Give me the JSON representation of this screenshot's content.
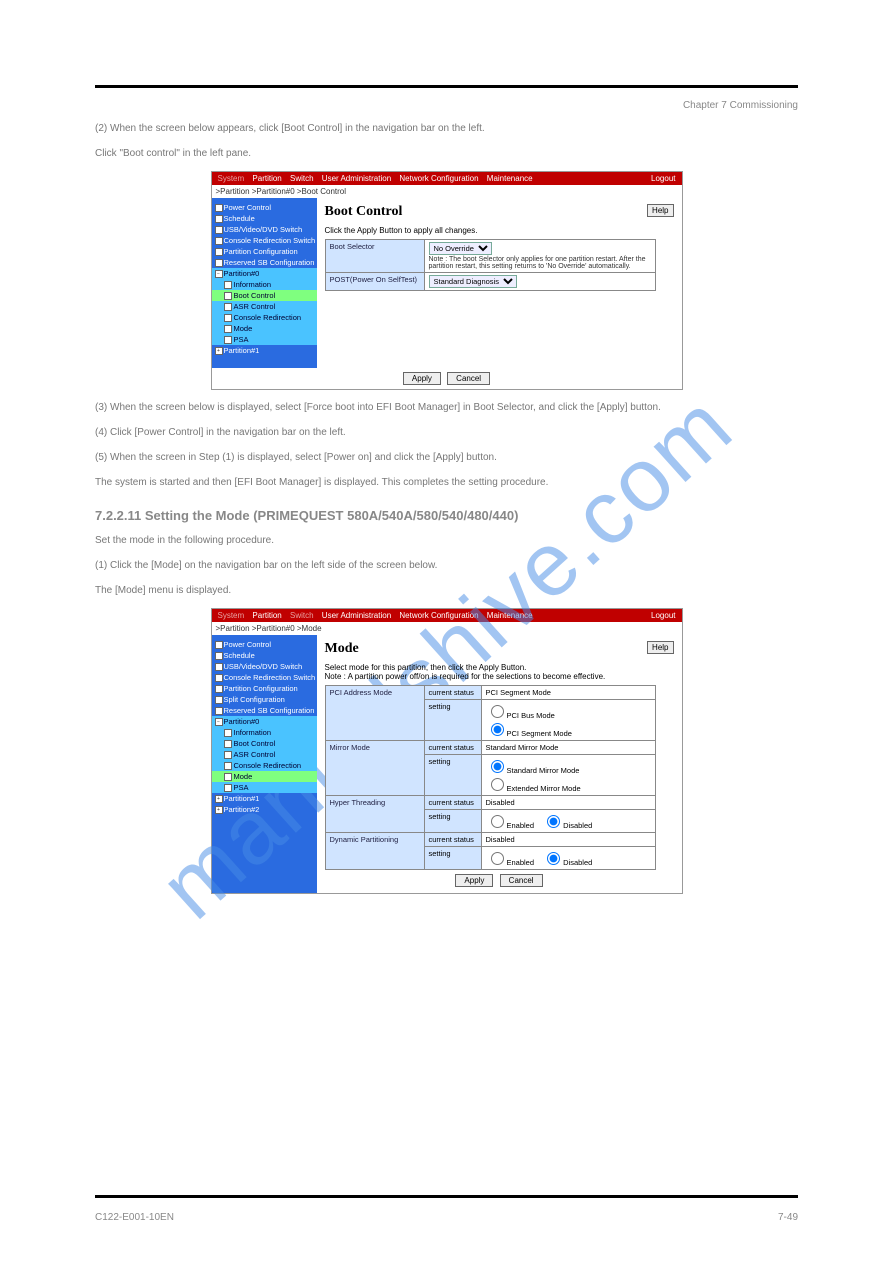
{
  "header": {
    "chapter": "Chapter 7 Commissioning"
  },
  "watermark": "manualshive.com",
  "intro": {
    "line1": "(2) When the screen below appears, click [Boot Control] in the navigation bar on the left.",
    "line2": "Click \"Boot control\" in the left pane."
  },
  "screenshot1": {
    "nav": [
      "System",
      "Partition",
      "Switch",
      "User Administration",
      "Network Configuration",
      "Maintenance"
    ],
    "logout": "Logout",
    "breadcrumb": ">Partition >Partition#0 >Boot Control",
    "sidebar": [
      "Power Control",
      "Schedule",
      "USB/Video/DVD Switch",
      "Console Redirection Switch",
      "Partition Configuration",
      "Reserved SB Configuration",
      "Partition#0",
      "Partition#1"
    ],
    "subitems": [
      "Information",
      "Boot Control",
      "ASR Control",
      "Console Redirection",
      "Mode",
      "PSA"
    ],
    "title": "Boot Control",
    "help": "Help",
    "instruction": "Click the Apply Button to apply all changes.",
    "rows": {
      "boot_selector_label": "Boot Selector",
      "boot_selector_value": "No Override",
      "boot_selector_note": "Note : The boot Selector only applies for one partition restart. After the partition restart, this setting returns to 'No Override' automatically.",
      "post_label": "POST(Power On SelfTest)",
      "post_value": "Standard Diagnosis"
    },
    "buttons": {
      "apply": "Apply",
      "cancel": "Cancel"
    }
  },
  "midtext": {
    "p1": "(3) When the screen below is displayed, select [Force boot into EFI Boot Manager] in Boot Selector, and click the [Apply] button.",
    "p2": "(4) Click [Power Control] in the navigation bar on the left.",
    "p3": "(5) When the screen in Step (1) is displayed, select [Power on] and click the [Apply] button.",
    "p4": "The system is started and then [EFI Boot Manager] is displayed. This completes the setting procedure.",
    "h": "7.2.2.11 Setting the Mode (PRIMEQUEST 580A/540A/580/540/480/440)",
    "p5": "Set the mode in the following procedure.",
    "p6": "(1) Click the [Mode] on the navigation bar on the left side of the screen below.",
    "p7": "The [Mode] menu is displayed."
  },
  "screenshot2": {
    "nav": [
      "System",
      "Partition",
      "Switch",
      "User Administration",
      "Network Configuration",
      "Maintenance"
    ],
    "logout": "Logout",
    "breadcrumb": ">Partition >Partition#0 >Mode",
    "sidebar": [
      "Power Control",
      "Schedule",
      "USB/Video/DVD Switch",
      "Console Redirection Switch",
      "Partition Configuration",
      "Split Configuration",
      "Reserved SB Configuration",
      "Partition#0",
      "Partition#1",
      "Partition#2"
    ],
    "subitems": [
      "Information",
      "Boot Control",
      "ASR Control",
      "Console Redirection",
      "Mode",
      "PSA"
    ],
    "title": "Mode",
    "help": "Help",
    "instruction1": "Select mode for this partition, then click the Apply Button.",
    "instruction2": "Note : A partition power off/on is required for the selections to become effective.",
    "rows": {
      "pci_label": "PCI Address Mode",
      "pci_current": "PCI Segment Mode",
      "pci_opt1": "PCI Bus Mode",
      "pci_opt2": "PCI Segment Mode",
      "mirror_label": "Mirror Mode",
      "mirror_current": "Standard Mirror Mode",
      "mirror_opt1": "Standard Mirror Mode",
      "mirror_opt2": "Extended Mirror Mode",
      "ht_label": "Hyper Threading",
      "ht_current": "Disabled",
      "dp_label": "Dynamic Partitioning",
      "dp_current": "Disabled",
      "opt_enabled": "Enabled",
      "opt_disabled": "Disabled",
      "col_current": "current status",
      "col_setting": "setting"
    },
    "buttons": {
      "apply": "Apply",
      "cancel": "Cancel"
    }
  },
  "footer": {
    "left": "C122-E001-10EN",
    "right": "7-49"
  }
}
